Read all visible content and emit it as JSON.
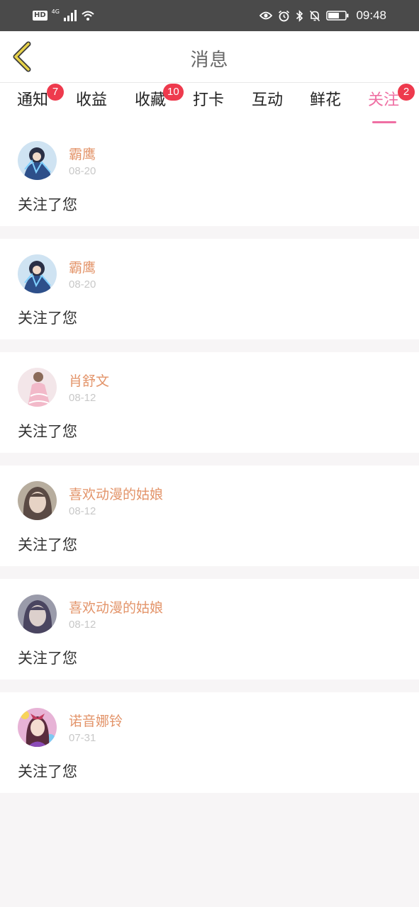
{
  "status_bar": {
    "hd": "HD",
    "network": "4G",
    "time": "09:48",
    "icons": [
      "eye-icon",
      "alarm-icon",
      "bluetooth-icon",
      "bell-off-icon",
      "battery-icon"
    ]
  },
  "header": {
    "title": "消息",
    "back_icon": "chevron-left-icon"
  },
  "tabs": [
    {
      "label": "通知",
      "badge": "7"
    },
    {
      "label": "收益",
      "badge": ""
    },
    {
      "label": "收藏",
      "badge": "10"
    },
    {
      "label": "打卡",
      "badge": ""
    },
    {
      "label": "互动",
      "badge": ""
    },
    {
      "label": "鲜花",
      "badge": ""
    },
    {
      "label": "关注",
      "badge": "2",
      "active": true
    }
  ],
  "colors": {
    "accent": "#ef6fa3",
    "username": "#e3946a",
    "badge": "#ee3a4d",
    "back_arrow": "#e8d24a"
  },
  "messages": [
    {
      "name": "霸鹰",
      "date": "08-20",
      "text": "关注了您"
    },
    {
      "name": "霸鹰",
      "date": "08-20",
      "text": "关注了您"
    },
    {
      "name": "肖舒文",
      "date": "08-12",
      "text": "关注了您"
    },
    {
      "name": "喜欢动漫的姑娘",
      "date": "08-12",
      "text": "关注了您"
    },
    {
      "name": "喜欢动漫的姑娘",
      "date": "08-12",
      "text": "关注了您"
    },
    {
      "name": "诺音娜铃",
      "date": "07-31",
      "text": "关注了您"
    }
  ]
}
